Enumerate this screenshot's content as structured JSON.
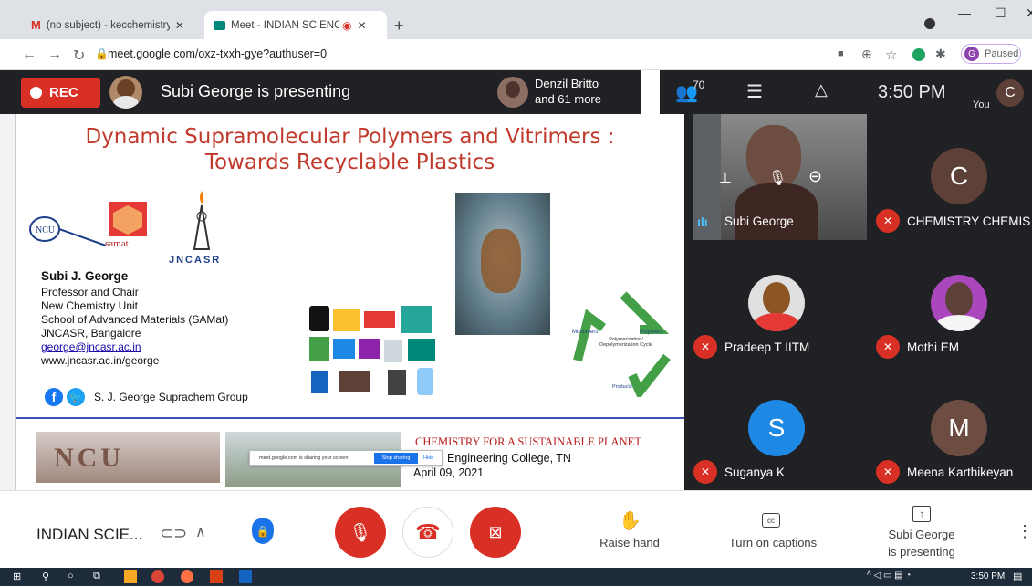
{
  "browser": {
    "tabs": [
      {
        "label": "(no subject) - kecchemistry@kon",
        "active": false
      },
      {
        "label": "Meet - INDIAN SCIENCE AC/",
        "active": true
      }
    ],
    "new_tab": "+",
    "url": "meet.google.com/oxz-txxh-gye?authuser=0",
    "profile_initial": "G",
    "profile_status": "Paused"
  },
  "meet_top": {
    "rec_label": "REC",
    "presenting_text": "Subi George is presenting",
    "others_line1": "Denzil Britto",
    "others_line2": "and 61 more",
    "participant_count": "70",
    "time": "3:50 PM",
    "you_initial": "C",
    "you_label": "You"
  },
  "slide": {
    "title_line1": "Dynamic Supramolecular Polymers and Vitrimers :",
    "title_line2": "Towards Recyclable Plastics",
    "logo_samat": "samat",
    "logo_ncu": "NCU",
    "logo_jncasr": "JNCASR",
    "presenter_name": "Subi J. George",
    "info_lines": [
      "Professor and  Chair",
      "New Chemistry Unit",
      "School of Advanced Materials (SAMat)",
      "JNCASR, Bangalore",
      "george@jncasr.ac.in",
      "www.jncasr.ac.in/george"
    ],
    "group_name": "S. J. George Suprachem Group",
    "cycle_monomers": "Monomers",
    "cycle_polymers": "Polymers",
    "cycle_center": "Polymerization/ Depolymerization Cycle",
    "cycle_products": "Products",
    "bottom_ncu": "NCU",
    "share_notice": "meet.google.com is sharing your screen.",
    "stop_sharing": "Stop sharing",
    "hide": "Hide",
    "chem_title": "CHEMISTRY FOR A SUSTAINABLE PLANET",
    "college": "Engineering College, TN",
    "date": "April 09, 2021"
  },
  "participants": [
    {
      "name": "Subi George",
      "muted": false
    },
    {
      "name": "CHEMISTRY CHEMIS",
      "initial": "C",
      "color": "#5d4037",
      "muted": true
    },
    {
      "name": "Pradeep T IITM",
      "muted": true
    },
    {
      "name": "Mothi EM",
      "muted": true
    },
    {
      "name": "Suganya K",
      "initial": "S",
      "color": "#1e88e5",
      "muted": true
    },
    {
      "name": "Meena Karthikeyan",
      "initial": "M",
      "color": "#6d4c41",
      "muted": true
    }
  ],
  "bottom": {
    "meeting_name": "INDIAN SCIE...",
    "raise_hand": "Raise hand",
    "captions": "Turn on captions",
    "present_line1": "Subi George",
    "present_line2": "is presenting"
  },
  "taskbar": {
    "time": "3:50 PM"
  },
  "colors": {
    "meet_dark": "#202124",
    "danger_red": "#d93025",
    "title_red": "#c0392b"
  }
}
